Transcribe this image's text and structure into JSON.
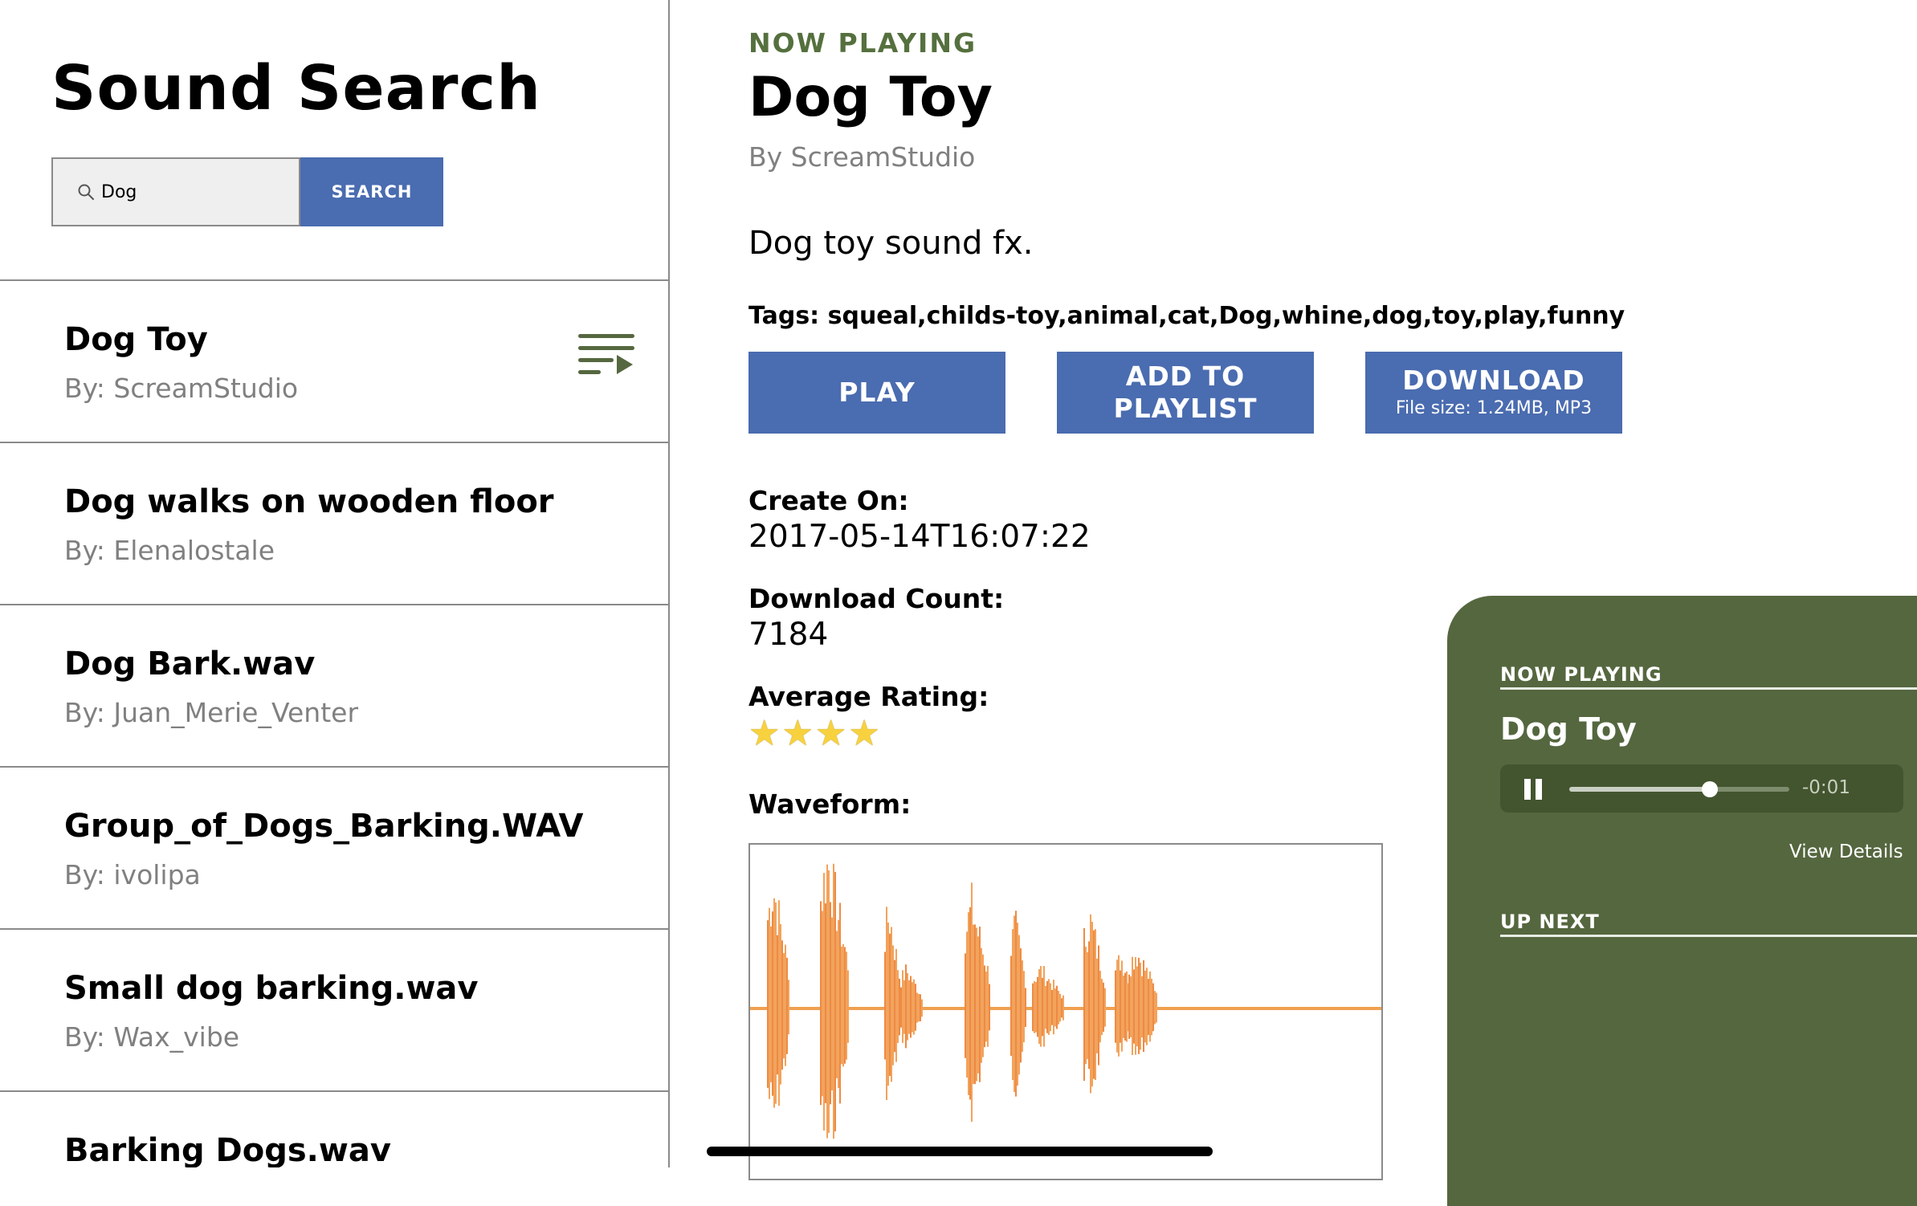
{
  "app": {
    "title": "Sound Search"
  },
  "search": {
    "value": "Dog",
    "button_label": "SEARCH"
  },
  "results": [
    {
      "title": "Dog Toy",
      "author": "By: ScreamStudio"
    },
    {
      "title": "Dog walks on wooden floor",
      "author": "By: Elenalostale"
    },
    {
      "title": "Dog Bark.wav",
      "author": "By: Juan_Merie_Venter"
    },
    {
      "title": "Group_of_Dogs_Barking.WAV",
      "author": "By: ivolipa"
    },
    {
      "title": "Small dog barking.wav",
      "author": "By: Wax_vibe"
    },
    {
      "title": "Barking Dogs.wav",
      "author": ""
    }
  ],
  "detail": {
    "eyebrow": "NOW PLAYING",
    "title": "Dog Toy",
    "author": "By ScreamStudio",
    "description": "Dog toy sound fx.",
    "tags_text": "Tags: squeal,childs-toy,animal,cat,Dog,whine,dog,toy,play,funny",
    "play_label": "PLAY",
    "playlist_label": "ADD TO PLAYLIST",
    "download_label": "DOWNLOAD",
    "download_sub": "File size: 1.24MB, MP3",
    "created_label": "Create On:",
    "created_value": "2017-05-14T16:07:22",
    "downloads_label": "Download Count:",
    "downloads_value": "7184",
    "rating_label": "Average Rating:",
    "rating_stars": 4,
    "waveform_label": "Waveform:"
  },
  "mini_player": {
    "now_playing_label": "NOW PLAYING",
    "title": "Dog Toy",
    "progress": 0.64,
    "time_remaining": "-0:01",
    "view_details_label": "View Details",
    "up_next_label": "UP NEXT"
  },
  "colors": {
    "accent_blue": "#4a6cb0",
    "player_green": "#55673f",
    "eyebrow_green": "#55703e",
    "waveform_orange": "#f0a050"
  },
  "icons": {
    "search": "search-icon",
    "queue": "play-queue-icon",
    "pause": "pause-icon",
    "star": "star-icon"
  }
}
